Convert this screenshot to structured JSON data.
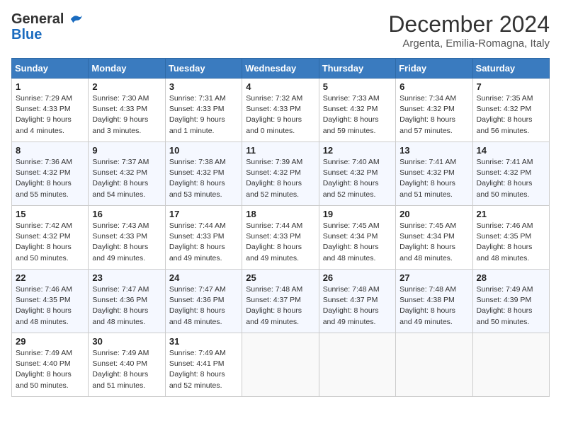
{
  "logo": {
    "text_general": "General",
    "text_blue": "Blue"
  },
  "title": "December 2024",
  "subtitle": "Argenta, Emilia-Romagna, Italy",
  "days_of_week": [
    "Sunday",
    "Monday",
    "Tuesday",
    "Wednesday",
    "Thursday",
    "Friday",
    "Saturday"
  ],
  "weeks": [
    [
      {
        "day": "1",
        "sunrise": "7:29 AM",
        "sunset": "4:33 PM",
        "daylight": "9 hours and 4 minutes."
      },
      {
        "day": "2",
        "sunrise": "7:30 AM",
        "sunset": "4:33 PM",
        "daylight": "9 hours and 3 minutes."
      },
      {
        "day": "3",
        "sunrise": "7:31 AM",
        "sunset": "4:33 PM",
        "daylight": "9 hours and 1 minute."
      },
      {
        "day": "4",
        "sunrise": "7:32 AM",
        "sunset": "4:33 PM",
        "daylight": "9 hours and 0 minutes."
      },
      {
        "day": "5",
        "sunrise": "7:33 AM",
        "sunset": "4:32 PM",
        "daylight": "8 hours and 59 minutes."
      },
      {
        "day": "6",
        "sunrise": "7:34 AM",
        "sunset": "4:32 PM",
        "daylight": "8 hours and 57 minutes."
      },
      {
        "day": "7",
        "sunrise": "7:35 AM",
        "sunset": "4:32 PM",
        "daylight": "8 hours and 56 minutes."
      }
    ],
    [
      {
        "day": "8",
        "sunrise": "7:36 AM",
        "sunset": "4:32 PM",
        "daylight": "8 hours and 55 minutes."
      },
      {
        "day": "9",
        "sunrise": "7:37 AM",
        "sunset": "4:32 PM",
        "daylight": "8 hours and 54 minutes."
      },
      {
        "day": "10",
        "sunrise": "7:38 AM",
        "sunset": "4:32 PM",
        "daylight": "8 hours and 53 minutes."
      },
      {
        "day": "11",
        "sunrise": "7:39 AM",
        "sunset": "4:32 PM",
        "daylight": "8 hours and 52 minutes."
      },
      {
        "day": "12",
        "sunrise": "7:40 AM",
        "sunset": "4:32 PM",
        "daylight": "8 hours and 52 minutes."
      },
      {
        "day": "13",
        "sunrise": "7:41 AM",
        "sunset": "4:32 PM",
        "daylight": "8 hours and 51 minutes."
      },
      {
        "day": "14",
        "sunrise": "7:41 AM",
        "sunset": "4:32 PM",
        "daylight": "8 hours and 50 minutes."
      }
    ],
    [
      {
        "day": "15",
        "sunrise": "7:42 AM",
        "sunset": "4:32 PM",
        "daylight": "8 hours and 50 minutes."
      },
      {
        "day": "16",
        "sunrise": "7:43 AM",
        "sunset": "4:33 PM",
        "daylight": "8 hours and 49 minutes."
      },
      {
        "day": "17",
        "sunrise": "7:44 AM",
        "sunset": "4:33 PM",
        "daylight": "8 hours and 49 minutes."
      },
      {
        "day": "18",
        "sunrise": "7:44 AM",
        "sunset": "4:33 PM",
        "daylight": "8 hours and 49 minutes."
      },
      {
        "day": "19",
        "sunrise": "7:45 AM",
        "sunset": "4:34 PM",
        "daylight": "8 hours and 48 minutes."
      },
      {
        "day": "20",
        "sunrise": "7:45 AM",
        "sunset": "4:34 PM",
        "daylight": "8 hours and 48 minutes."
      },
      {
        "day": "21",
        "sunrise": "7:46 AM",
        "sunset": "4:35 PM",
        "daylight": "8 hours and 48 minutes."
      }
    ],
    [
      {
        "day": "22",
        "sunrise": "7:46 AM",
        "sunset": "4:35 PM",
        "daylight": "8 hours and 48 minutes."
      },
      {
        "day": "23",
        "sunrise": "7:47 AM",
        "sunset": "4:36 PM",
        "daylight": "8 hours and 48 minutes."
      },
      {
        "day": "24",
        "sunrise": "7:47 AM",
        "sunset": "4:36 PM",
        "daylight": "8 hours and 48 minutes."
      },
      {
        "day": "25",
        "sunrise": "7:48 AM",
        "sunset": "4:37 PM",
        "daylight": "8 hours and 49 minutes."
      },
      {
        "day": "26",
        "sunrise": "7:48 AM",
        "sunset": "4:37 PM",
        "daylight": "8 hours and 49 minutes."
      },
      {
        "day": "27",
        "sunrise": "7:48 AM",
        "sunset": "4:38 PM",
        "daylight": "8 hours and 49 minutes."
      },
      {
        "day": "28",
        "sunrise": "7:49 AM",
        "sunset": "4:39 PM",
        "daylight": "8 hours and 50 minutes."
      }
    ],
    [
      {
        "day": "29",
        "sunrise": "7:49 AM",
        "sunset": "4:40 PM",
        "daylight": "8 hours and 50 minutes."
      },
      {
        "day": "30",
        "sunrise": "7:49 AM",
        "sunset": "4:40 PM",
        "daylight": "8 hours and 51 minutes."
      },
      {
        "day": "31",
        "sunrise": "7:49 AM",
        "sunset": "4:41 PM",
        "daylight": "8 hours and 52 minutes."
      },
      null,
      null,
      null,
      null
    ]
  ]
}
